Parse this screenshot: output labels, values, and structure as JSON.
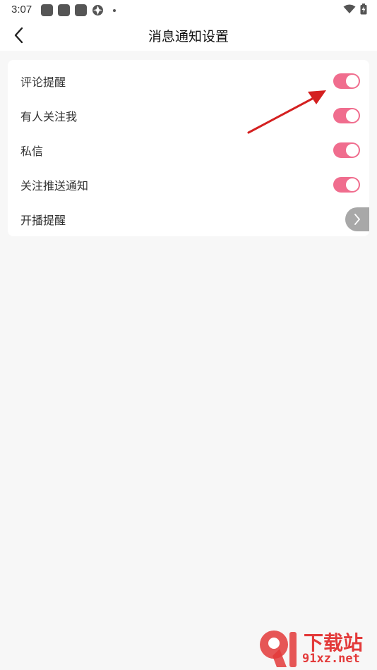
{
  "status_bar": {
    "time": "3:07"
  },
  "header": {
    "title": "消息通知设置",
    "back_icon": "chevron-left-icon"
  },
  "settings": [
    {
      "label": "评论提醒",
      "control": "toggle",
      "value": true
    },
    {
      "label": "有人关注我",
      "control": "toggle",
      "value": true
    },
    {
      "label": "私信",
      "control": "toggle",
      "value": true
    },
    {
      "label": "关注推送通知",
      "control": "toggle",
      "value": true
    },
    {
      "label": "开播提醒",
      "control": "chevron",
      "icon": "chevron-right-icon"
    }
  ],
  "colors": {
    "toggle_on": "#f06d8e",
    "background": "#f7f7f7",
    "card": "#ffffff",
    "annotation_arrow": "#d42020",
    "watermark": "#e33a3a"
  },
  "watermark": {
    "line1": "下载站",
    "line2": "91xz.net",
    "logo_text": "9"
  }
}
